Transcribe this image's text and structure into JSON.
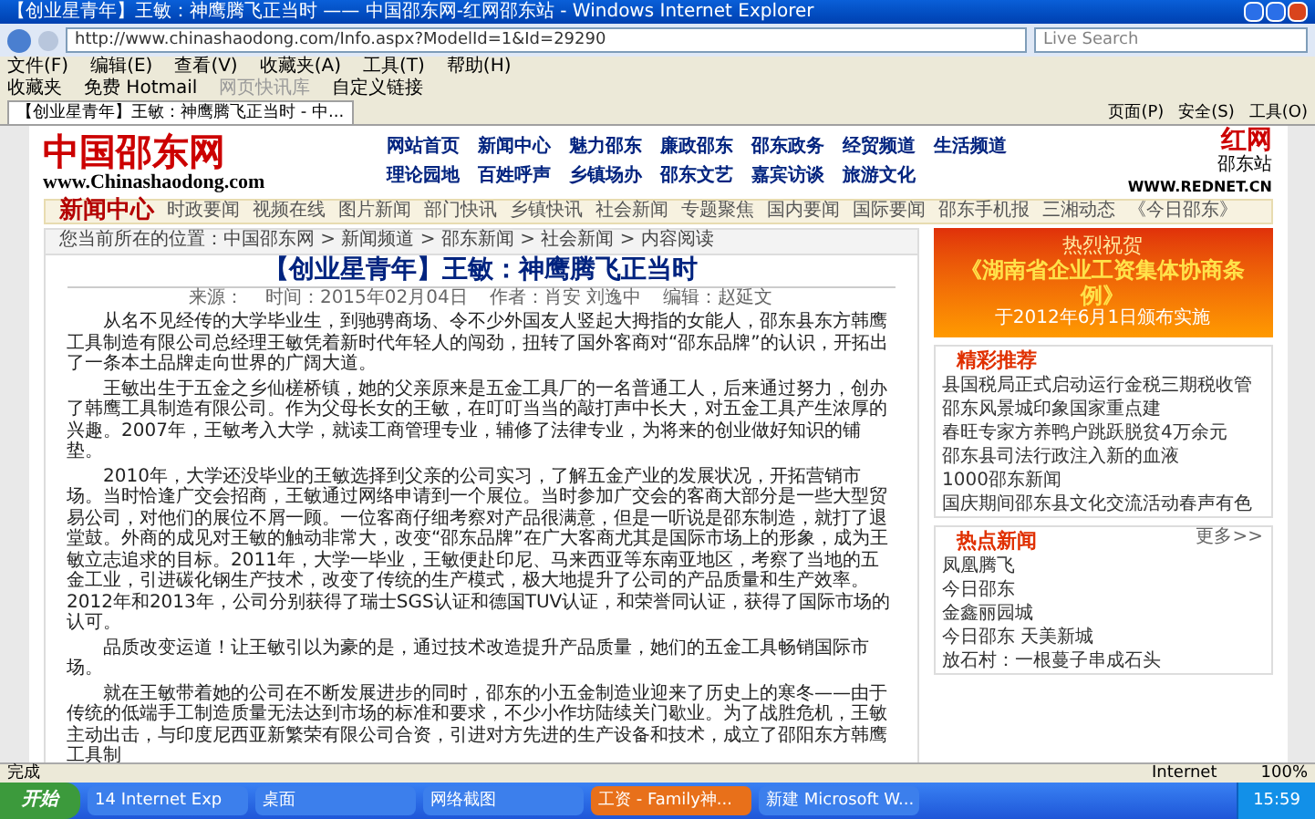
{
  "window": {
    "title": "【创业星青年】王敏：神鹰腾飞正当时 —— 中国邵东网-红网邵东站 - Windows Internet Explorer"
  },
  "address_bar": {
    "value": "http://www.chinashaodong.com/Info.aspx?ModelId=1&Id=29290",
    "search_placeholder": "Live Search"
  },
  "menu": [
    "文件(F)",
    "编辑(E)",
    "查看(V)",
    "收藏夹(A)",
    "工具(T)",
    "帮助(H)"
  ],
  "favorites_bar": [
    {
      "label": "收藏夹",
      "disabled": false
    },
    {
      "label": "免费 Hotmail",
      "disabled": false
    },
    {
      "label": "网页快讯库",
      "disabled": true
    },
    {
      "label": "自定义链接",
      "disabled": false
    }
  ],
  "tab": {
    "label": "【创业星青年】王敏：神鹰腾飞正当时 - 中..."
  },
  "command_bar": [
    "页面(P)",
    "安全(S)",
    "工具(O)"
  ],
  "site": {
    "logo": "中国邵东网",
    "logo_url": "www.Chinashaodong.com",
    "partner_logo": "红网",
    "partner_sub": "邵东站",
    "partner_url": "WWW.REDNET.CN",
    "nav": [
      [
        "网站首页",
        "新闻中心",
        "魅力邵东",
        "廉政邵东",
        "邵东政务",
        "经贸频道",
        "生活频道"
      ],
      [
        "理论园地",
        "百姓呼声",
        "乡镇场办",
        "邵东文艺",
        "嘉宾访谈",
        "旅游文化"
      ]
    ],
    "section": "新闻中心",
    "subnav": [
      "时政要闻",
      "视频在线",
      "图片新闻",
      "部门快讯",
      "乡镇快讯",
      "社会新闻",
      "专题聚焦",
      "国内要闻",
      "国际要闻",
      "邵东手机报",
      "三湘动态",
      "《今日邵东》"
    ]
  },
  "breadcrumb": "您当前所在的位置：中国邵东网 > 新闻频道 > 邵东新闻 > 社会新闻 > 内容阅读",
  "article": {
    "title": "【创业星青年】王敏：神鹰腾飞正当时",
    "meta": [
      "来源：",
      "时间：2015年02月04日",
      "作者：肖安 刘逸中",
      "编辑：赵延文"
    ],
    "paragraphs": [
      "从名不见经传的大学毕业生，到驰骋商场、令不少外国友人竖起大拇指的女能人，邵东县东方韩鹰工具制造有限公司总经理王敏凭着新时代年轻人的闯劲，扭转了国外客商对“邵东品牌”的认识，开拓出了一条本土品牌走向世界的广阔大道。",
      "王敏出生于五金之乡仙槎桥镇，她的父亲原来是五金工具厂的一名普通工人，后来通过努力，创办了韩鹰工具制造有限公司。作为父母长女的王敏，在叮叮当当的敲打声中长大，对五金工具产生浓厚的兴趣。2007年，王敏考入大学，就读工商管理专业，辅修了法律专业，为将来的创业做好知识的铺垫。",
      "2010年，大学还没毕业的王敏选择到父亲的公司实习，了解五金产业的发展状况，开拓营销市场。当时恰逢广交会招商，王敏通过网络申请到一个展位。当时参加广交会的客商大部分是一些大型贸易公司，对他们的展位不屑一顾。一位客商仔细考察对产品很满意，但是一听说是邵东制造，就打了退堂鼓。外商的成见对王敏的触动非常大，改变“邵东品牌”在广大客商尤其是国际市场上的形象，成为王敏立志追求的目标。2011年，大学一毕业，王敏便赴印尼、马来西亚等东南亚地区，考察了当地的五金工业，引进碳化钢生产技术，改变了传统的生产模式，极大地提升了公司的产品质量和生产效率。2012年和2013年，公司分别获得了瑞士SGS认证和德国TUV认证，和荣誉同认证，获得了国际市场的认可。",
      "品质改变运道！让王敏引以为豪的是，通过技术改造提升产品质量，她们的五金工具畅销国际市场。",
      "就在王敏带着她的公司在不断发展进步的同时，邵东的小五金制造业迎来了历史上的寒冬——由于传统的低端手工制造质量无法达到市场的标准和要求，不少小作坊陆续关门歇业。为了战胜危机，王敏主动出击，与印度尼西亚新繁荣有限公司合资，引进对方先进的生产设备和技术，成立了邵阳东方韩鹰工具制"
    ]
  },
  "sidebar": {
    "banner": [
      "热烈祝贺",
      "《湖南省企业工资集体协商条例》",
      "于2012年6月1日颁布实施"
    ],
    "recommended": {
      "title": "精彩推荐",
      "items": [
        "县国税局正式启动运行金税三期税收管",
        "邵东风景城印象国家重点建",
        "春旺专家方养鸭户跳跃脱贫4万余元",
        "邵东县司法行政注入新的血液",
        "1000邵东新闻",
        "国庆期间邵东县文化交流活动春声有色"
      ]
    },
    "hot_news": {
      "title": "热点新闻",
      "more": "更多>>",
      "items": [
        "凤凰腾飞",
        "今日邵东",
        "金鑫丽园城",
        "今日邵东 天美新城",
        "放石村：一根蔓子串成石头"
      ]
    }
  },
  "status_bar": {
    "text": "完成",
    "zone": "Internet",
    "zoom": "100%"
  },
  "taskbar": {
    "start": "开始",
    "tasks": [
      {
        "label": "14 Internet Exp",
        "selected": false
      },
      {
        "label": "桌面",
        "selected": false
      },
      {
        "label": "网络截图",
        "selected": false
      },
      {
        "label": "工资 - Family神...",
        "selected": true
      },
      {
        "label": "新建 Microsoft W...",
        "selected": false
      }
    ],
    "clock": "15:59"
  }
}
